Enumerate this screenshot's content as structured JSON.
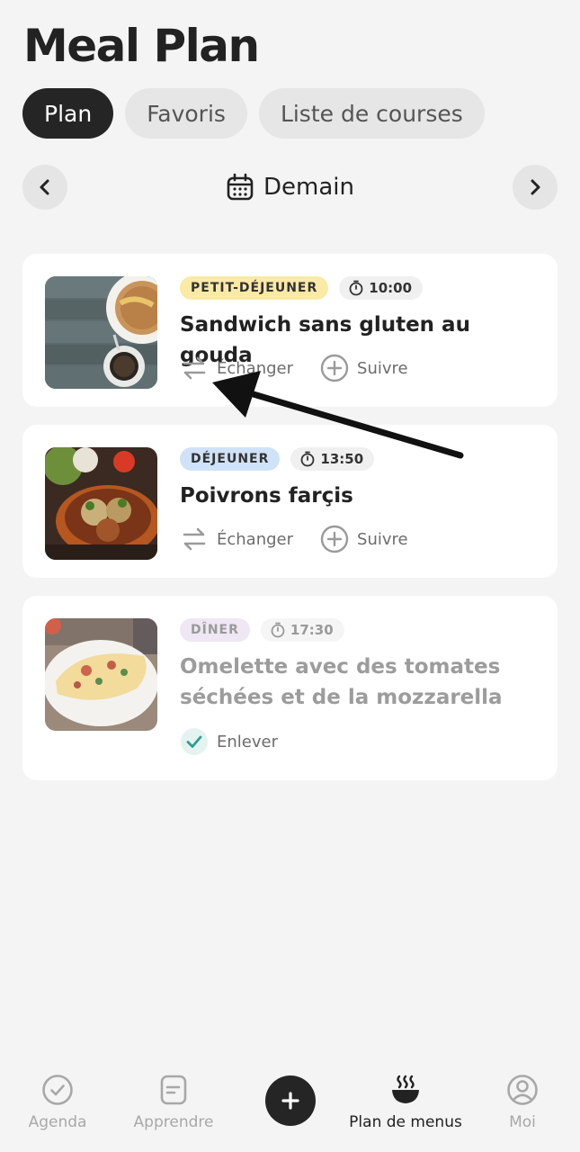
{
  "header": {
    "title": "Meal Plan"
  },
  "tabs": [
    {
      "label": "Plan",
      "active": true
    },
    {
      "label": "Favoris",
      "active": false
    },
    {
      "label": "Liste de courses",
      "active": false
    }
  ],
  "date_nav": {
    "label": "Demain",
    "prev_icon": "chevron-left-icon",
    "next_icon": "chevron-right-icon",
    "calendar_icon": "calendar-icon"
  },
  "meals": [
    {
      "badge": "PETIT-DÉJEUNER",
      "time": "10:00",
      "name": "Sandwich sans gluten au gouda",
      "actions": {
        "swap": "Échanger",
        "track": "Suivre"
      }
    },
    {
      "badge": "DÉJEUNER",
      "time": "13:50",
      "name": "Poivrons farçis",
      "actions": {
        "swap": "Échanger",
        "track": "Suivre"
      }
    },
    {
      "badge": "DÎNER",
      "time": "17:30",
      "name": "Omelette avec des tomates séchées et de la mozzarella",
      "actions": {
        "remove": "Enlever"
      },
      "done": true
    }
  ],
  "bottom_nav": {
    "items": [
      {
        "label": "Agenda",
        "icon": "check-circle-icon"
      },
      {
        "label": "Apprendre",
        "icon": "note-icon"
      },
      {
        "label": "Plan de menus",
        "icon": "bowl-icon",
        "active": true
      },
      {
        "label": "Moi",
        "icon": "user-icon"
      }
    ],
    "add_icon": "plus-icon"
  },
  "colors": {
    "background": "#f4f4f4",
    "dark": "#252525",
    "breakfast_badge": "#fbeaa6",
    "lunch_badge": "#cfe2f7",
    "dinner_badge": "#efe7f3",
    "check_accent": "#2f9e8f"
  }
}
